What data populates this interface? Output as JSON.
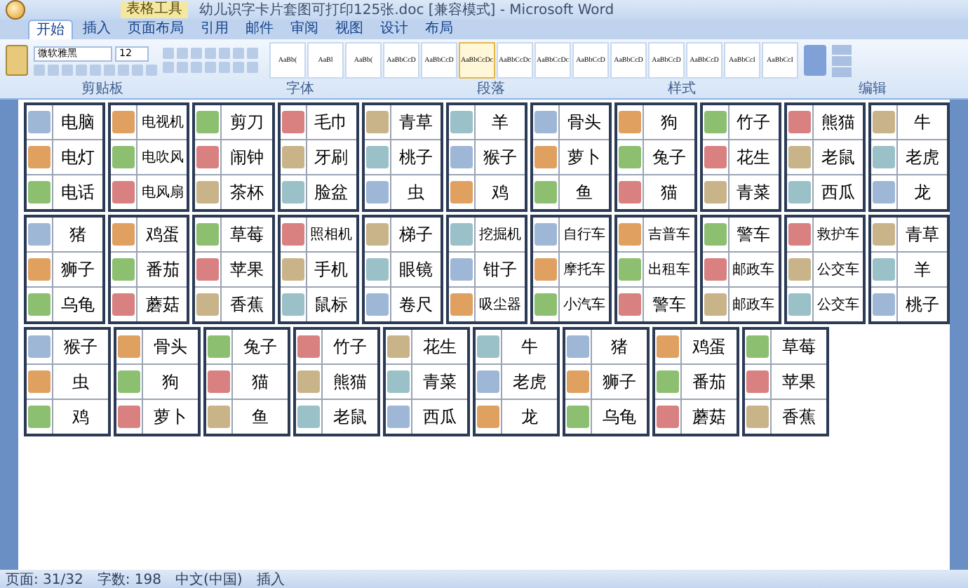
{
  "window": {
    "title": "幼儿识字卡片套图可打印125张.doc [兼容模式] - Microsoft Word",
    "context_tab": "表格工具"
  },
  "tabs": [
    {
      "label": "开始",
      "selected": true
    },
    {
      "label": "插入",
      "selected": false
    },
    {
      "label": "页面布局",
      "selected": false
    },
    {
      "label": "引用",
      "selected": false
    },
    {
      "label": "邮件",
      "selected": false
    },
    {
      "label": "审阅",
      "selected": false
    },
    {
      "label": "视图",
      "selected": false
    },
    {
      "label": "设计",
      "selected": false
    },
    {
      "label": "布局",
      "selected": false
    }
  ],
  "ribbon": {
    "font_name": "微软雅黑",
    "font_size": "12",
    "styles": [
      "AaBb(",
      "AaBl",
      "AaBb(",
      "AaBbCcD",
      "AaBbCcD",
      "AaBbCcDc",
      "AaBbCcDc",
      "AaBbCcDc",
      "AaBbCcD",
      "AaBbCcD",
      "AaBbCcD",
      "AaBbCcD",
      "AaBbCcI",
      "AaBbCcI"
    ],
    "groups": [
      "剪贴板",
      "字体",
      "段落",
      "样式",
      "编辑"
    ]
  },
  "card_rows": [
    [
      [
        "电脑",
        "电灯",
        "电话"
      ],
      [
        "电视机",
        "电吹风",
        "电风扇"
      ],
      [
        "剪刀",
        "闹钟",
        "茶杯"
      ],
      [
        "毛巾",
        "牙刷",
        "脸盆"
      ],
      [
        "青草",
        "桃子",
        "虫"
      ],
      [
        "羊",
        "猴子",
        "鸡"
      ],
      [
        "骨头",
        "萝卜",
        "鱼"
      ],
      [
        "狗",
        "兔子",
        "猫"
      ],
      [
        "竹子",
        "花生",
        "青菜"
      ],
      [
        "熊猫",
        "老鼠",
        "西瓜"
      ],
      [
        "牛",
        "老虎",
        "龙"
      ]
    ],
    [
      [
        "猪",
        "狮子",
        "乌龟"
      ],
      [
        "鸡蛋",
        "番茄",
        "蘑菇"
      ],
      [
        "草莓",
        "苹果",
        "香蕉"
      ],
      [
        "照相机",
        "手机",
        "鼠标"
      ],
      [
        "梯子",
        "眼镜",
        "卷尺"
      ],
      [
        "挖掘机",
        "钳子",
        "吸尘器"
      ],
      [
        "自行车",
        "摩托车",
        "小汽车"
      ],
      [
        "吉普车",
        "出租车",
        "警车"
      ],
      [
        "警车",
        "邮政车",
        "邮政车"
      ],
      [
        "救护车",
        "公交车",
        "公交车"
      ],
      [
        "青草",
        "羊",
        "桃子"
      ]
    ],
    [
      [
        "猴子",
        "虫",
        "鸡"
      ],
      [
        "骨头",
        "狗",
        "萝卜"
      ],
      [
        "兔子",
        "猫",
        "鱼"
      ],
      [
        "竹子",
        "熊猫",
        "老鼠"
      ],
      [
        "花生",
        "青菜",
        "西瓜"
      ],
      [
        "牛",
        "老虎",
        "龙"
      ],
      [
        "猪",
        "狮子",
        "乌龟"
      ],
      [
        "鸡蛋",
        "番茄",
        "蘑菇"
      ],
      [
        "草莓",
        "苹果",
        "香蕉"
      ]
    ]
  ],
  "status_bar": [
    "页面: 31/32",
    "字数: 198",
    "中文(中国)",
    "插入"
  ]
}
